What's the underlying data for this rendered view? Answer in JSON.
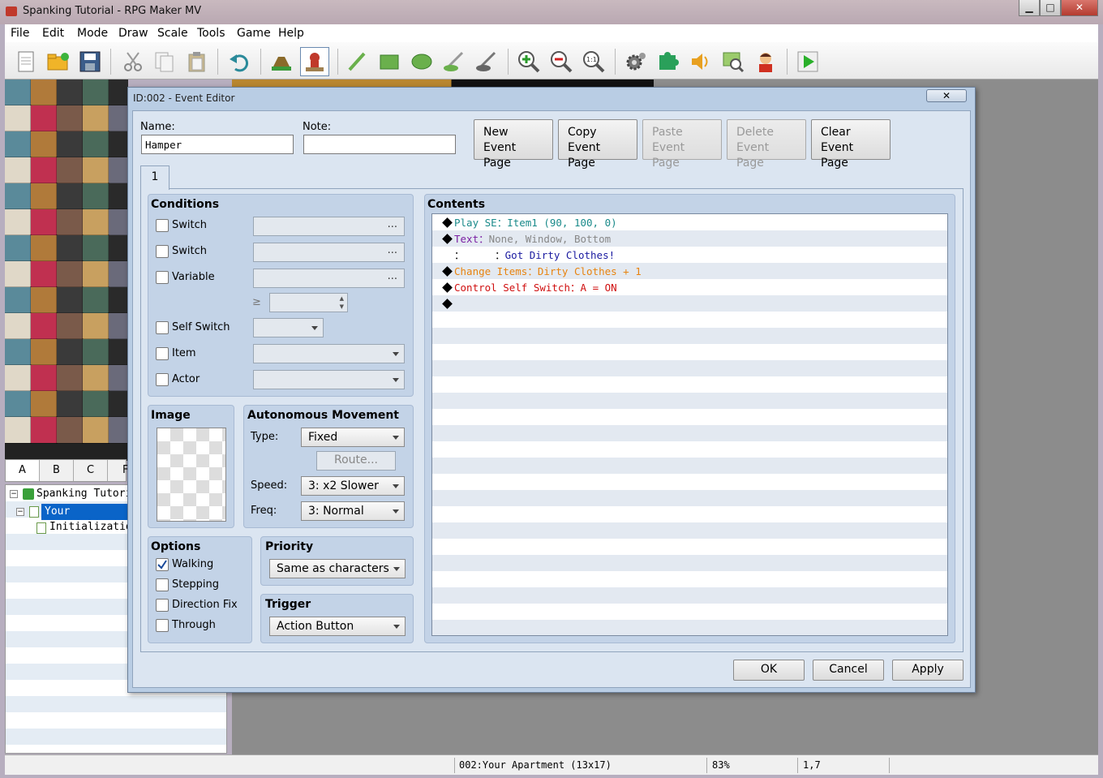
{
  "app": {
    "title": "Spanking Tutorial - RPG Maker MV"
  },
  "window_buttons": {
    "minimize": "▁",
    "maximize": "□",
    "close": "✕"
  },
  "menu": [
    "File",
    "Edit",
    "Mode",
    "Draw",
    "Scale",
    "Tools",
    "Game",
    "Help"
  ],
  "toolbar": [
    {
      "name": "new-project",
      "icon": "new-document-icon"
    },
    {
      "name": "open-project",
      "icon": "open-folder-icon"
    },
    {
      "name": "save-project",
      "icon": "save-icon"
    },
    {
      "name": "cut",
      "icon": "scissors-icon"
    },
    {
      "name": "copy",
      "icon": "copy-icon"
    },
    {
      "name": "paste",
      "icon": "paste-icon"
    },
    {
      "name": "undo",
      "icon": "undo-icon"
    },
    {
      "name": "map-mode",
      "icon": "map-icon"
    },
    {
      "name": "event-mode",
      "icon": "event-icon"
    },
    {
      "name": "pencil",
      "icon": "pencil-icon"
    },
    {
      "name": "rectangle",
      "icon": "rectangle-icon"
    },
    {
      "name": "ellipse",
      "icon": "ellipse-icon"
    },
    {
      "name": "fill",
      "icon": "fill-icon"
    },
    {
      "name": "shadow-pen",
      "icon": "shadow-pen-icon"
    },
    {
      "name": "zoom-in",
      "icon": "zoom-in-icon"
    },
    {
      "name": "zoom-out",
      "icon": "zoom-out-icon"
    },
    {
      "name": "zoom-actual",
      "icon": "zoom-actual-icon"
    },
    {
      "name": "database",
      "icon": "gear-icon"
    },
    {
      "name": "plugin-manager",
      "icon": "puzzle-icon"
    },
    {
      "name": "sound-test",
      "icon": "speaker-icon"
    },
    {
      "name": "event-searcher",
      "icon": "search-icon"
    },
    {
      "name": "character-generator",
      "icon": "character-icon"
    },
    {
      "name": "playtest",
      "icon": "play-icon"
    }
  ],
  "tileset_tabs": [
    "A",
    "B",
    "C",
    "F"
  ],
  "map_tree": [
    {
      "label": "Spanking Tutorial",
      "level": 0,
      "selected": false
    },
    {
      "label": "Your Apartment",
      "level": 1,
      "selected": true
    },
    {
      "label": "Initialization",
      "level": 2,
      "selected": false
    }
  ],
  "status": {
    "map": "002:Your Apartment (13x17)",
    "zoom": "83%",
    "coords": "1,7"
  },
  "dialog": {
    "title": "ID:002 - Event Editor",
    "close": "✕",
    "name_label": "Name:",
    "name_value": "Hamper",
    "note_label": "Note:",
    "note_value": "",
    "page_buttons": [
      {
        "line1": "New",
        "line2": "Event Page",
        "enabled": true
      },
      {
        "line1": "Copy",
        "line2": "Event Page",
        "enabled": true
      },
      {
        "line1": "Paste",
        "line2": "Event Page",
        "enabled": false
      },
      {
        "line1": "Delete",
        "line2": "Event Page",
        "enabled": false
      },
      {
        "line1": "Clear",
        "line2": "Event Page",
        "enabled": true
      }
    ],
    "page_tab": "1",
    "conditions": {
      "title": "Conditions",
      "switch1": "Switch",
      "switch2": "Switch",
      "variable": "Variable",
      "ge": "≥",
      "self_switch": "Self Switch",
      "item": "Item",
      "actor": "Actor",
      "ellipsis": "..."
    },
    "image": {
      "title": "Image"
    },
    "movement": {
      "title": "Autonomous Movement",
      "type_label": "Type:",
      "type_value": "Fixed",
      "route": "Route...",
      "speed_label": "Speed:",
      "speed_value": "3: x2 Slower",
      "freq_label": "Freq:",
      "freq_value": "3: Normal"
    },
    "options": {
      "title": "Options",
      "walking": "Walking",
      "walking_checked": true,
      "stepping": "Stepping",
      "direction_fix": "Direction Fix",
      "through": "Through"
    },
    "priority": {
      "title": "Priority",
      "value": "Same as characters"
    },
    "trigger": {
      "title": "Trigger",
      "value": "Action Button"
    },
    "contents": {
      "title": "Contents",
      "lines": [
        {
          "cmd": "Play SE",
          "sep": "：",
          "args": "Item1 (90, 100, 0)",
          "color": "#1a8a8a",
          "argcolor": "#1a8a8a",
          "diamond": true
        },
        {
          "cmd": "Text",
          "sep": "：",
          "args": "None, Window, Bottom",
          "color": "#7a1fa2",
          "argcolor": "#888888",
          "diamond": true
        },
        {
          "cmd": "：     ",
          "sep": "：",
          "args": "Got Dirty Clothes!",
          "color": "#000000",
          "argcolor": "#1a1aa0",
          "diamond": false
        },
        {
          "cmd": "Change Items",
          "sep": "：",
          "args": "Dirty Clothes + 1",
          "color": "#e8830f",
          "argcolor": "#e8830f",
          "diamond": true
        },
        {
          "cmd": "Control Self Switch",
          "sep": "：",
          "args": "A = ON",
          "color": "#d01010",
          "argcolor": "#d01010",
          "diamond": true
        },
        {
          "cmd": "",
          "sep": "",
          "args": "",
          "color": "#000000",
          "argcolor": "#000000",
          "diamond": true
        }
      ]
    },
    "ok": "OK",
    "cancel": "Cancel",
    "apply": "Apply"
  }
}
